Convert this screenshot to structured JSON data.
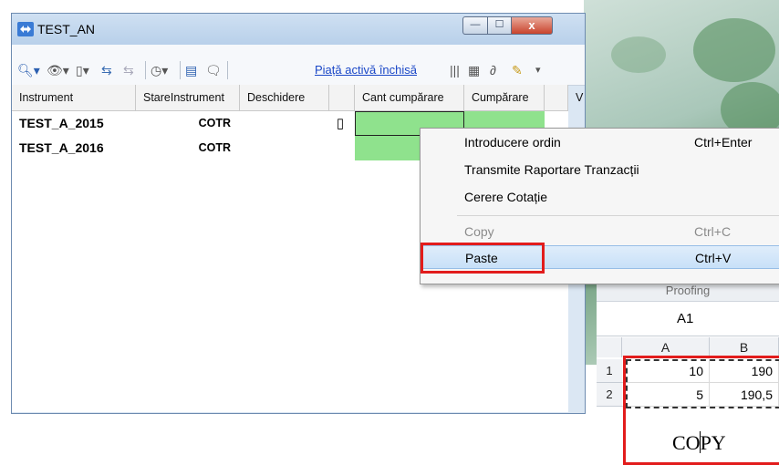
{
  "window": {
    "title": "TEST_AN",
    "buttons": {
      "minimize": "—",
      "maximize": "☐",
      "close": "x"
    }
  },
  "toolbar": {
    "icons": [
      "search-icon",
      "eye-icon",
      "notepad-icon",
      "exchange-icon",
      "exchange-disabled-icon",
      "clock-icon",
      "panels-icon",
      "speech-bubble-icon",
      "chart-bars-icon",
      "table-icon",
      "paperclip-icon",
      "pen-icon",
      "overflow-chevron-icon"
    ],
    "market_status": "Piață activă închisă"
  },
  "grid": {
    "columns": [
      "Instrument",
      "StareInstrument",
      "Deschidere",
      "",
      "Cant cumpărare",
      "Cumpărare",
      "",
      "V"
    ],
    "rows": [
      {
        "instrument": "TEST_A_2015",
        "stare": "COTR",
        "deschidere": ""
      },
      {
        "instrument": "TEST_A_2016",
        "stare": "COTR",
        "deschidere": ""
      }
    ]
  },
  "context_menu": {
    "items": [
      {
        "label": "Introducere ordin",
        "shortcut": "Ctrl+Enter",
        "enabled": true
      },
      {
        "label": "Transmite Raportare Tranzacții",
        "shortcut": "",
        "enabled": true
      },
      {
        "label": "Cerere Cotație",
        "shortcut": "",
        "enabled": true
      },
      {
        "label": "Copy",
        "shortcut": "Ctrl+C",
        "enabled": false
      },
      {
        "label": "Paste",
        "shortcut": "Ctrl+V",
        "enabled": true,
        "highlighted": true
      }
    ]
  },
  "excel": {
    "ribbon_group": "Proofing",
    "name_box": "A1",
    "columns": [
      "A",
      "B"
    ],
    "rows": [
      {
        "num": "1",
        "a": "10",
        "b": "190"
      },
      {
        "num": "2",
        "a": "5",
        "b": "190,5"
      }
    ]
  },
  "annotation": {
    "text": "COPY"
  },
  "colors": {
    "highlight_red": "#e21c1c",
    "cell_green": "#8fe28d",
    "link_blue": "#1a47c7"
  }
}
